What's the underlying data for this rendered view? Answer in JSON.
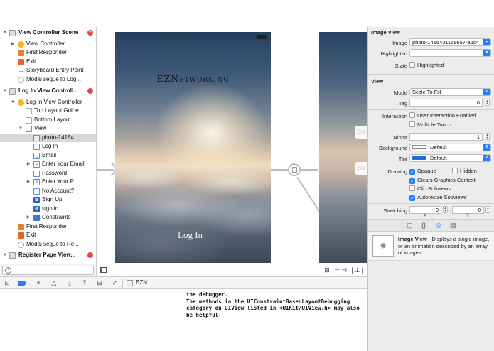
{
  "outline": {
    "rows": [
      {
        "label": "View Controller Scene",
        "icon": "scene-icon",
        "badge": true
      },
      {
        "label": "View Controller",
        "icon": "view-controller-icon"
      },
      {
        "label": "First Responder",
        "icon": "first-responder-icon"
      },
      {
        "label": "Exit",
        "icon": "exit-icon"
      },
      {
        "label": "Storyboard Entry Point",
        "icon": "arrow-icon"
      },
      {
        "label": "Modal segue to Log...",
        "icon": "modal-segue-icon"
      },
      {
        "label": "Log In View Controll...",
        "icon": "scene-icon",
        "badge": true
      },
      {
        "label": "Log In View Controller",
        "icon": "view-controller-icon"
      },
      {
        "label": "Top Layout Guide",
        "icon": "layout-guide-icon"
      },
      {
        "label": "Bottom Layout...",
        "icon": "layout-guide-icon"
      },
      {
        "label": "View",
        "icon": "view-icon"
      },
      {
        "label": "photo-14164...",
        "icon": "image-view-icon"
      },
      {
        "label": "Log In",
        "icon": "label-icon"
      },
      {
        "label": "Email",
        "icon": "label-icon"
      },
      {
        "label": "Enter Your Email",
        "icon": "text-field-icon"
      },
      {
        "label": "Password",
        "icon": "label-icon"
      },
      {
        "label": "Enter Your P...",
        "icon": "text-field-icon"
      },
      {
        "label": "No Account?",
        "icon": "label-icon"
      },
      {
        "label": "Sign Up",
        "icon": "button-icon"
      },
      {
        "label": "sign in",
        "icon": "button-icon"
      },
      {
        "label": "Constraints",
        "icon": "constraints-icon"
      },
      {
        "label": "First Responder",
        "icon": "first-responder-icon"
      },
      {
        "label": "Exit",
        "icon": "exit-icon"
      },
      {
        "label": "Modal segue to Re...",
        "icon": "modal-segue-icon"
      },
      {
        "label": "Register Page View...",
        "icon": "scene-icon",
        "badge": true
      }
    ],
    "icon_glyphs": {
      "label": "L",
      "text_field": "F",
      "button": "B",
      "constraints": "|⊟|",
      "arrow": "→",
      "modal": "◎"
    }
  },
  "canvas": {
    "app_title": "EZNetworking",
    "login_text": "Log In",
    "placeholder_1": "Ent",
    "placeholder_2": "Ent"
  },
  "debug": {
    "breadcrumb": "EZN",
    "console_text": "the debugger.\nThe methods in the UIConstraintBasedLayoutDebugging\ncategory on UIView listed in <UIKit/UIView.h> may also\nbe helpful."
  },
  "inspector": {
    "image_view_section": "Image View",
    "image_label": "Image",
    "image_value": "photo-1416431168657-a6c4",
    "highlighted_label": "Highlighted",
    "highlighted_value": "",
    "state_label": "State",
    "state_highlighted": "Highlighted",
    "view_section": "View",
    "mode_label": "Mode",
    "mode_value": "Scale To Fill",
    "tag_label": "Tag",
    "tag_value": "0",
    "interaction_label": "Interaction",
    "user_interaction": "User Interaction Enabled",
    "multiple_touch": "Multiple Touch",
    "alpha_label": "Alpha",
    "alpha_value": "1",
    "background_label": "Background",
    "background_value": "Default",
    "tint_label": "Tint",
    "tint_value": "Default",
    "drawing_label": "Drawing",
    "opaque": "Opaque",
    "hidden": "Hidden",
    "clears_graphics": "Clears Graphics Context",
    "clip_subviews": "Clip Subviews",
    "autoresize_subviews": "Autoresize Subviews",
    "stretching_label": "Stretching",
    "stretch_x": "0",
    "stretch_y": "0",
    "x_label": "X",
    "y_label": "Y",
    "lib_title": "Image View",
    "lib_desc": " - Displays a single image, or an animation described by an array of images.",
    "checks": {
      "state_highlighted": false,
      "user_interaction": false,
      "multiple_touch": false,
      "opaque": true,
      "hidden": false,
      "clears_graphics": true,
      "clip_subviews": false,
      "autoresize_subviews": true
    },
    "colors": {
      "accent": "#2a7ef5",
      "tint_swatch": "#1f6fd6",
      "background_swatch": "#ffffff"
    }
  }
}
